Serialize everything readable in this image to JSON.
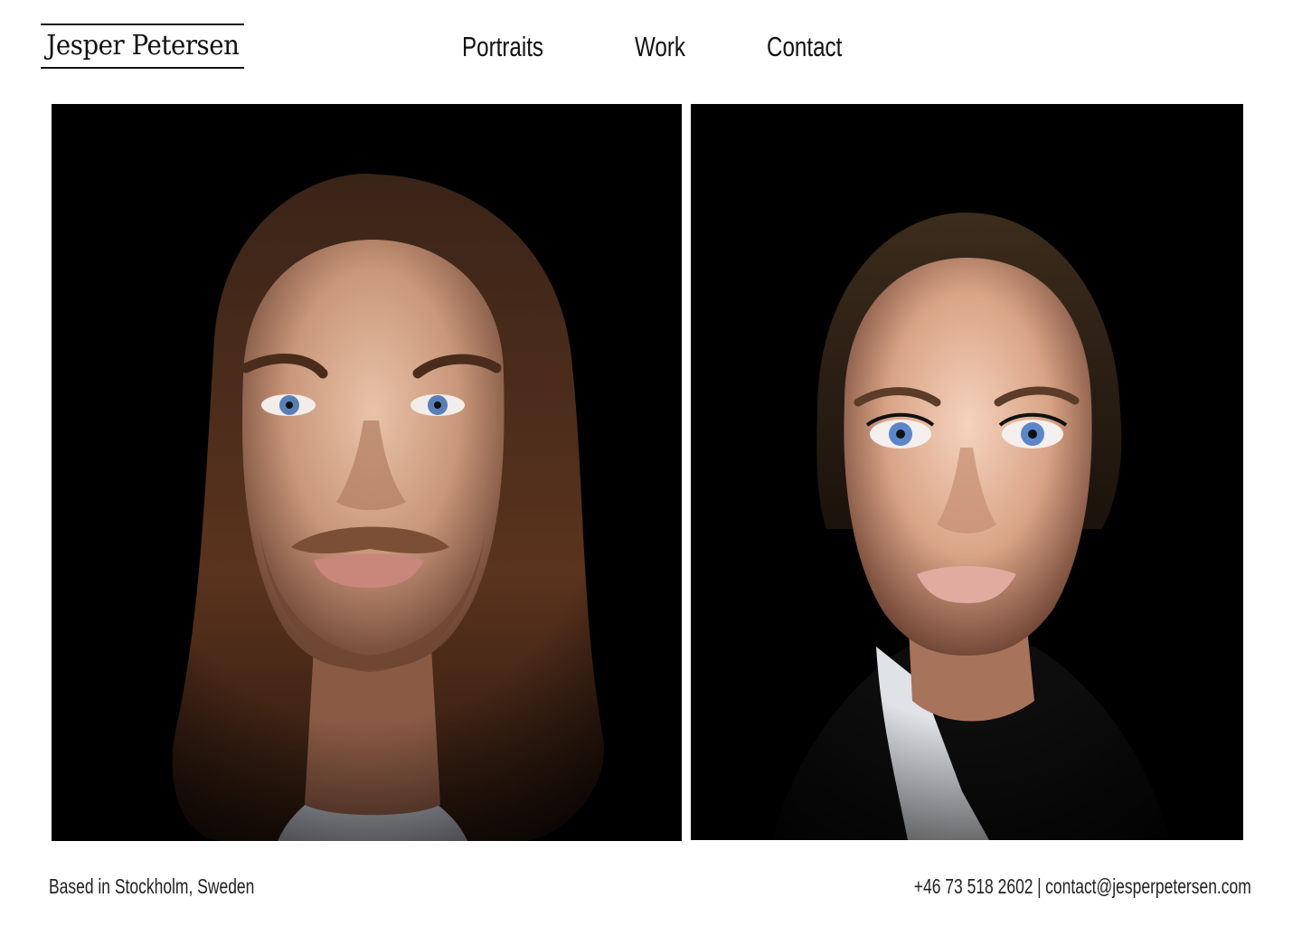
{
  "header": {
    "logo_text": "Jesper Petersen",
    "nav": [
      {
        "label": "Portraits"
      },
      {
        "label": "Work"
      },
      {
        "label": "Contact"
      }
    ]
  },
  "gallery": {
    "photos": [
      {
        "subject": "man-with-long-hair-portrait"
      },
      {
        "subject": "woman-portrait"
      }
    ]
  },
  "footer": {
    "location": "Based in Stockholm, Sweden",
    "phone": "+46 73 518 2602",
    "separator": "|",
    "email": "contact@jesperpetersen.com"
  },
  "colors": {
    "background": "#ffffff",
    "text": "#111111",
    "photo_background": "#000000"
  }
}
